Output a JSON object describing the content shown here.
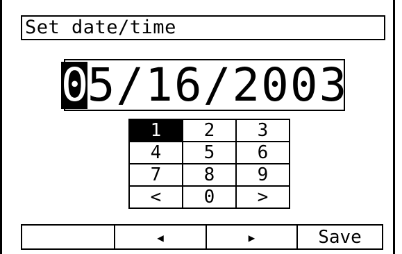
{
  "title": "Set date/time",
  "date": {
    "cursor_char": "0",
    "rest": "5/16/2003"
  },
  "keypad": {
    "selected": "1",
    "rows": [
      [
        "1",
        "2",
        "3"
      ],
      [
        "4",
        "5",
        "6"
      ],
      [
        "7",
        "8",
        "9"
      ],
      [
        "<",
        "0",
        ">"
      ]
    ]
  },
  "softkeys": {
    "key1": "",
    "key2_icon": "left-triangle-icon",
    "key3_icon": "right-triangle-icon",
    "key4": "Save"
  }
}
